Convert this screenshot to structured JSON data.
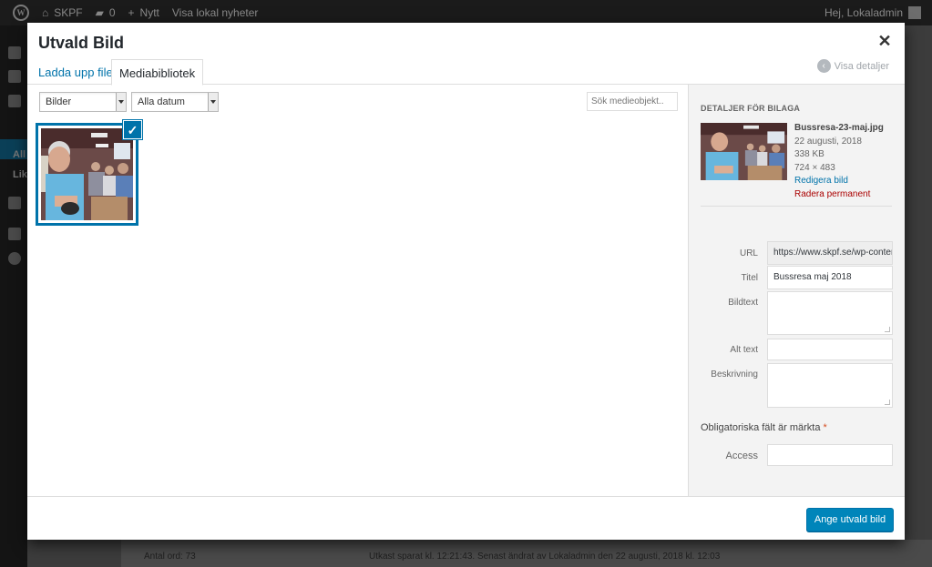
{
  "adminbar": {
    "site": "SKPF",
    "comments": "0",
    "new": "Nytt",
    "view": "Visa lokal nyheter",
    "greeting": "Hej, Lokaladmin"
  },
  "adminmenu": {
    "sub1": "All",
    "sub2": "Lik"
  },
  "statusbar": {
    "wordcount": "Antal ord: 73",
    "saved": "Utkast sparat kl. 12:21:43. Senast ändrat av Lokaladmin den 22 augusti, 2018 kl. 12:03"
  },
  "modal": {
    "title": "Utvald Bild",
    "tabs": [
      {
        "label": "Ladda upp filer"
      },
      {
        "label": "Mediabibliotek"
      }
    ],
    "show_details": "Visa detaljer",
    "filter_type": "Bilder",
    "filter_date": "Alla datum",
    "search_placeholder": "Sök medieobjekt...",
    "details": {
      "heading": "Detaljer för bilaga",
      "filename": "Bussresa-23-maj.jpg",
      "date": "22 augusti, 2018",
      "size": "338 KB",
      "dimensions": "724 × 483",
      "edit": "Redigera bild",
      "delete": "Radera permanent",
      "url_label": "URL",
      "url_value": "https://www.skpf.se/wp-conter",
      "title_label": "Titel",
      "title_value": "Bussresa maj 2018",
      "caption_label": "Bildtext",
      "alt_label": "Alt text",
      "description_label": "Beskrivning",
      "required_note": "Obligatoriska fält är märkta",
      "required_star": "*",
      "access_label": "Access"
    },
    "submit": "Ange utvald bild"
  },
  "colors": {
    "primary": "#0085ba",
    "link": "#0073aa",
    "delete": "#aa0000"
  }
}
